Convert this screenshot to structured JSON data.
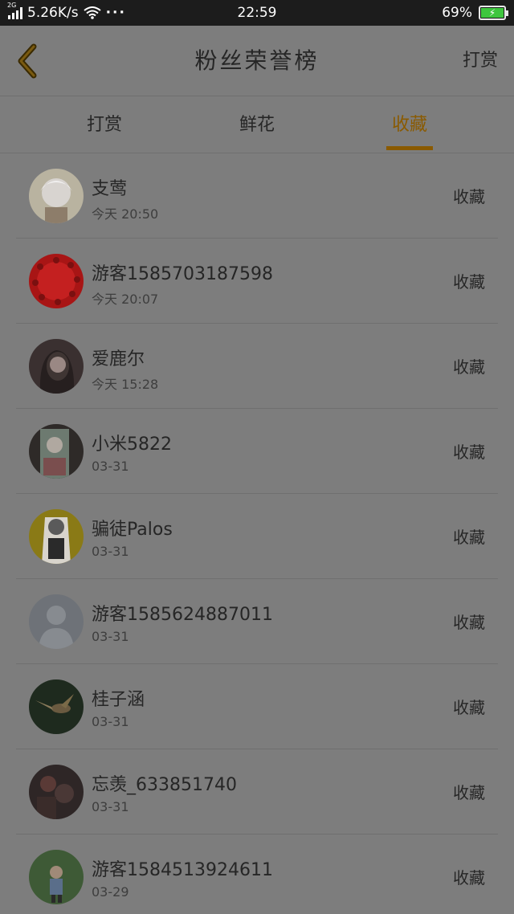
{
  "status_bar": {
    "network_tag": "2G",
    "speed": "5.26K/s",
    "dots": "···",
    "time": "22:59",
    "battery": "69%",
    "battery_level": 0.69
  },
  "header": {
    "title": "粉丝荣誉榜",
    "action": "打赏"
  },
  "tabs": [
    {
      "label": "打赏",
      "active": false
    },
    {
      "label": "鲜花",
      "active": false
    },
    {
      "label": "收藏",
      "active": true
    }
  ],
  "colors": {
    "accent": "#8a5a00",
    "background": "#7d7d7d",
    "status_bar": "#1c1c1c"
  },
  "list": [
    {
      "name": "支莺",
      "time": "今天 20:50",
      "action": "收藏",
      "avatar": "anime-avatar"
    },
    {
      "name": "游客1585703187598",
      "time": "今天 20:07",
      "action": "收藏",
      "avatar": "red-beads-avatar"
    },
    {
      "name": "爱鹿尔",
      "time": "今天 15:28",
      "action": "收藏",
      "avatar": "girl-avatar"
    },
    {
      "name": "小米5822",
      "time": "03-31",
      "action": "收藏",
      "avatar": "anime-green-avatar"
    },
    {
      "name": "骗徒Palos",
      "time": "03-31",
      "action": "收藏",
      "avatar": "yellow-anime-avatar"
    },
    {
      "name": "游客1585624887011",
      "time": "03-31",
      "action": "收藏",
      "avatar": "default-avatar"
    },
    {
      "name": "桂子涵",
      "time": "03-31",
      "action": "收藏",
      "avatar": "hummingbird-avatar"
    },
    {
      "name": "忘羡_633851740",
      "time": "03-31",
      "action": "收藏",
      "avatar": "dark-art-avatar"
    },
    {
      "name": "游客1584513924611",
      "time": "03-29",
      "action": "收藏",
      "avatar": "child-avatar"
    }
  ]
}
